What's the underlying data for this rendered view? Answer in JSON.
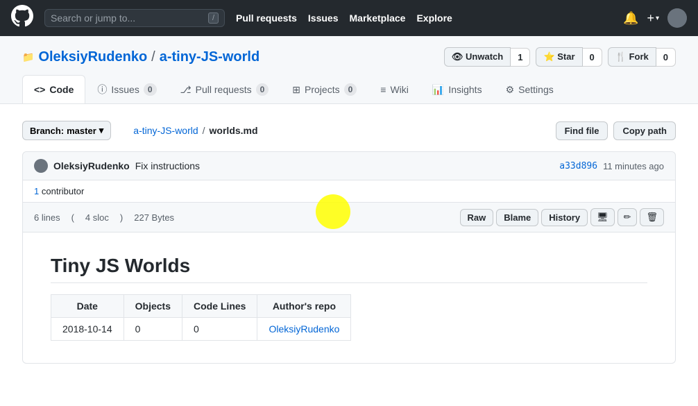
{
  "nav": {
    "search_placeholder": "Search or jump to...",
    "slash_key": "/",
    "links": [
      {
        "label": "Pull requests",
        "key": "pull-requests"
      },
      {
        "label": "Issues",
        "key": "issues"
      },
      {
        "label": "Marketplace",
        "key": "marketplace"
      },
      {
        "label": "Explore",
        "key": "explore"
      }
    ],
    "bell_icon": "🔔",
    "plus_icon": "+",
    "dropdown_arrow": "▾"
  },
  "repo": {
    "owner": "OleksiyRudenko",
    "separator": "/",
    "name": "a-tiny-JS-world",
    "watch_label": "👁 Unwatch",
    "watch_count": "1",
    "star_label": "⭐ Star",
    "star_count": "0",
    "fork_label": "🍴 Fork",
    "fork_count": "0"
  },
  "tabs": [
    {
      "label": "Code",
      "icon": "<>",
      "badge": null,
      "active": true,
      "key": "code"
    },
    {
      "label": "Issues",
      "icon": "ⓘ",
      "badge": "0",
      "active": false,
      "key": "issues"
    },
    {
      "label": "Pull requests",
      "icon": "⎇",
      "badge": "0",
      "active": false,
      "key": "pull-requests"
    },
    {
      "label": "Projects",
      "icon": "⊞",
      "badge": "0",
      "active": false,
      "key": "projects"
    },
    {
      "label": "Wiki",
      "icon": "≡",
      "badge": null,
      "active": false,
      "key": "wiki"
    },
    {
      "label": "Insights",
      "icon": "📊",
      "badge": null,
      "active": false,
      "key": "insights"
    },
    {
      "label": "Settings",
      "icon": "⚙",
      "badge": null,
      "active": false,
      "key": "settings"
    }
  ],
  "branch": {
    "label": "Branch:",
    "name": "master",
    "arrow": "▾"
  },
  "file_path": {
    "repo_link": "a-tiny-JS-world",
    "separator": "/",
    "file_name": "worlds.md"
  },
  "file_actions": {
    "find_file": "Find file",
    "copy_path": "Copy path"
  },
  "commit": {
    "author": "OleksiyRudenko",
    "message": "Fix instructions",
    "sha": "a33d896",
    "time": "11 minutes ago"
  },
  "contributor": {
    "count": "1",
    "label": "contributor"
  },
  "file_stats": {
    "lines": "6 lines",
    "sloc": "4 sloc",
    "size": "227 Bytes"
  },
  "file_buttons": {
    "raw": "Raw",
    "blame": "Blame",
    "history": "History"
  },
  "file_content": {
    "title": "Tiny JS Worlds",
    "table": {
      "headers": [
        "Date",
        "Objects",
        "Code Lines",
        "Author's repo"
      ],
      "rows": [
        {
          "date": "2018-10-14",
          "objects": "0",
          "code_lines": "0",
          "repo_link_label": "OleksiyRudenko",
          "repo_link_href": "#"
        }
      ]
    }
  }
}
